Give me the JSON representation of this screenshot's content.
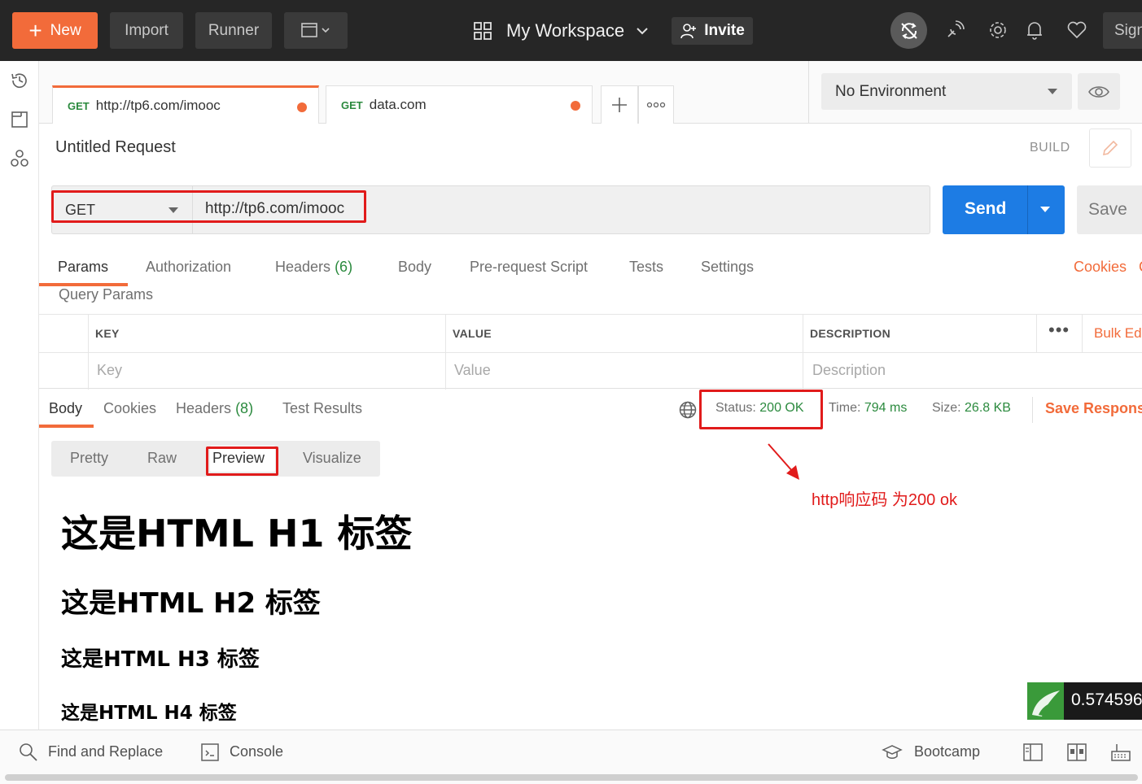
{
  "topbar": {
    "new_label": "New",
    "import_label": "Import",
    "runner_label": "Runner",
    "workspace_label": "My Workspace",
    "invite_label": "Invite",
    "signin_label": "Sign"
  },
  "tabs": [
    {
      "method": "GET",
      "url": "http://tp6.com/imooc"
    },
    {
      "method": "GET",
      "url": "data.com"
    }
  ],
  "environment": {
    "selected": "No Environment"
  },
  "request": {
    "title": "Untitled Request",
    "build_label": "BUILD",
    "method": "GET",
    "url": "http://tp6.com/imooc",
    "send_label": "Send",
    "save_label": "Save"
  },
  "request_tabs": {
    "params": "Params",
    "authorization": "Authorization",
    "headers": "Headers",
    "headers_count": "(6)",
    "body": "Body",
    "prerequest": "Pre-request Script",
    "tests": "Tests",
    "settings": "Settings",
    "cookies": "Cookies",
    "cookies_more": "C"
  },
  "query_params": {
    "label": "Query Params",
    "col_key": "KEY",
    "col_value": "VALUE",
    "col_description": "DESCRIPTION",
    "bulk_edit": "Bulk Ed",
    "placeholder_key": "Key",
    "placeholder_value": "Value",
    "placeholder_description": "Description"
  },
  "response": {
    "tab_body": "Body",
    "tab_cookies": "Cookies",
    "tab_headers": "Headers",
    "headers_count": "(8)",
    "tab_test_results": "Test Results",
    "status_label": "Status:",
    "status_value": "200 OK",
    "time_label": "Time:",
    "time_value": "794 ms",
    "size_label": "Size:",
    "size_value": "26.8 KB",
    "save_response": "Save Respons"
  },
  "format_tabs": {
    "pretty": "Pretty",
    "raw": "Raw",
    "preview": "Preview",
    "visualize": "Visualize"
  },
  "annotation": "http响应码 为200 ok",
  "preview": {
    "h1": "这是HTML H1 标签",
    "h2": "这是HTML H2 标签",
    "h3": "这是HTML H3 标签",
    "h4": "这是HTML H4 标签"
  },
  "widget_value": "0.574596",
  "statusbar": {
    "find_replace": "Find and Replace",
    "console": "Console",
    "bootcamp": "Bootcamp"
  },
  "colors": {
    "accent_orange": "#f26b3a",
    "send_blue": "#1d7ce4",
    "highlight_red": "#e11b1b",
    "ok_green": "#2b8a3e"
  }
}
